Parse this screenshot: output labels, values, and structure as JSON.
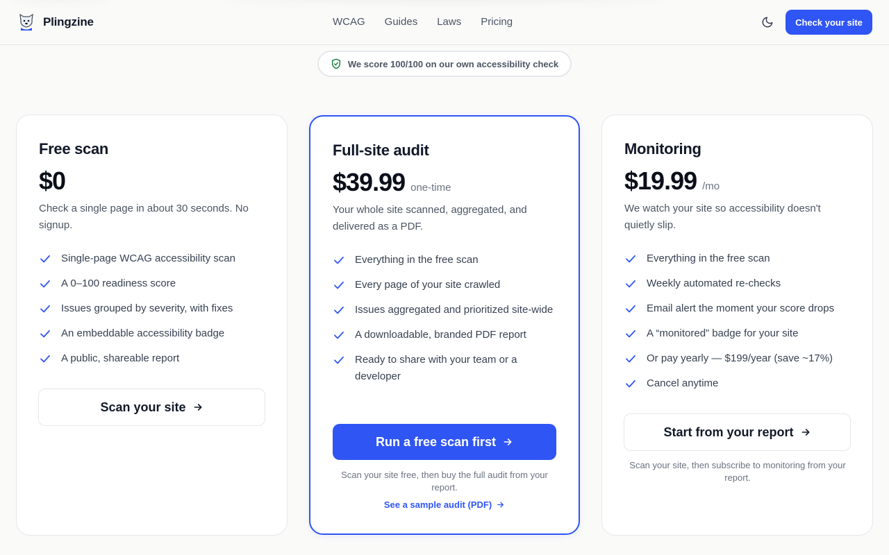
{
  "header": {
    "brand": "Plingzine",
    "nav": [
      "WCAG",
      "Guides",
      "Laws",
      "Pricing"
    ],
    "cta_label": "Check your site"
  },
  "score_pill": "We score 100/100 on our own accessibility check",
  "plans": [
    {
      "title": "Free scan",
      "price": "$0",
      "suffix": "",
      "description": "Check a single page in about 30 seconds. No signup.",
      "features": [
        "Single-page WCAG accessibility scan",
        "A 0–100 readiness score",
        "Issues grouped by severity, with fixes",
        "An embeddable accessibility badge",
        "A public, shareable report"
      ],
      "button_label": "Scan your site"
    },
    {
      "title": "Full-site audit",
      "price": "$39.99",
      "suffix": "one-time",
      "description": "Your whole site scanned, aggregated, and delivered as a PDF.",
      "features": [
        "Everything in the free scan",
        "Every page of your site crawled",
        "Issues aggregated and prioritized site-wide",
        "A downloadable, branded PDF report",
        "Ready to share with your team or a developer"
      ],
      "button_label": "Run a free scan first",
      "note": "Scan your site free, then buy the full audit from your report.",
      "link_label": "See a sample audit (PDF)"
    },
    {
      "title": "Monitoring",
      "price": "$19.99",
      "suffix": "/mo",
      "description": "We watch your site so accessibility doesn't quietly slip.",
      "features": [
        "Everything in the free scan",
        "Weekly automated re-checks",
        "Email alert the moment your score drops",
        "A “monitored” badge for your site",
        "Or pay yearly — $199/year (save ~17%)",
        "Cancel anytime"
      ],
      "button_label": "Start from your report",
      "note": "Scan your site, then subscribe to monitoring from your report."
    }
  ],
  "colors": {
    "accent": "#2f55f4",
    "shield": "#15803d",
    "background": "#fafaf9"
  }
}
